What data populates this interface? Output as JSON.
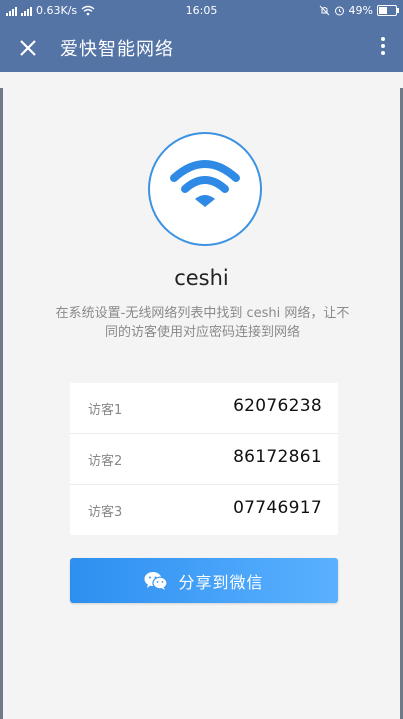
{
  "status_bar": {
    "network_speed": "0.63K/s",
    "time": "16:05",
    "battery": "49%"
  },
  "app_bar": {
    "title": "爱快智能网络"
  },
  "network": {
    "ssid": "ceshi",
    "description": "在系统设置-无线网络列表中找到 ceshi 网络，让不同的访客使用对应密码连接到网络"
  },
  "guests": [
    {
      "label": "访客1",
      "password": "62076238"
    },
    {
      "label": "访客2",
      "password": "86172861"
    },
    {
      "label": "访客3",
      "password": "07746917"
    }
  ],
  "share": {
    "label": "分享到微信"
  },
  "colors": {
    "app_bar": "#5474a6",
    "accent": "#3d92e3",
    "button": "#2d8ff0"
  }
}
